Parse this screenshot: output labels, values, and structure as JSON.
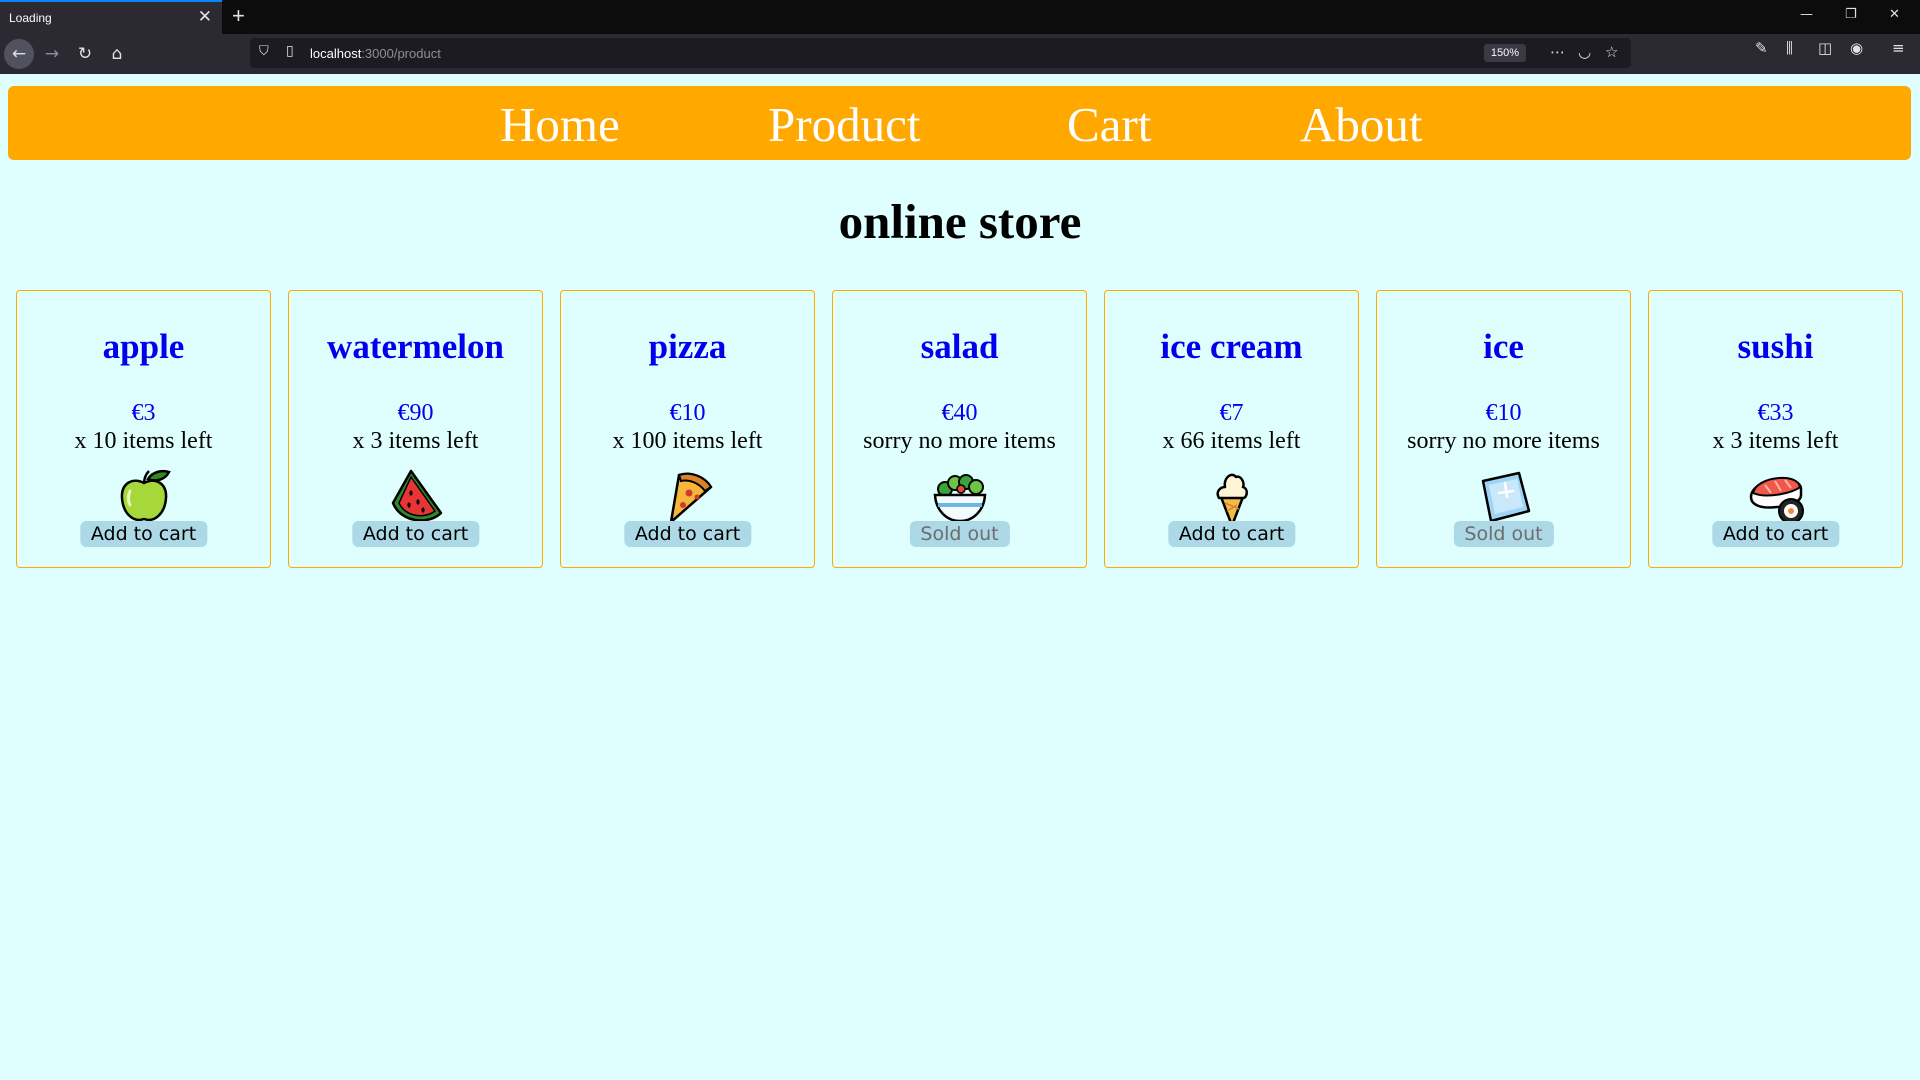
{
  "browser": {
    "tab_title": "Loading",
    "url_host": "localhost",
    "url_path": ":3000/product",
    "zoom": "150%"
  },
  "nav": {
    "items": [
      "Home",
      "Product",
      "Cart",
      "About"
    ]
  },
  "page": {
    "title": "online store"
  },
  "products": [
    {
      "name": "apple",
      "price": "€3",
      "stock": "x 10 items left",
      "button": "Add to cart",
      "available": true,
      "icon": "green-apple-icon"
    },
    {
      "name": "watermelon",
      "price": "€90",
      "stock": "x 3 items left",
      "button": "Add to cart",
      "available": true,
      "icon": "watermelon-icon"
    },
    {
      "name": "pizza",
      "price": "€10",
      "stock": "x 100 items left",
      "button": "Add to cart",
      "available": true,
      "icon": "pizza-icon"
    },
    {
      "name": "salad",
      "price": "€40",
      "stock": "sorry no more items",
      "button": "Sold out",
      "available": false,
      "icon": "salad-icon"
    },
    {
      "name": "ice cream",
      "price": "€7",
      "stock": "x 66 items left",
      "button": "Add to cart",
      "available": true,
      "icon": "ice-cream-icon"
    },
    {
      "name": "ice",
      "price": "€10",
      "stock": "sorry no more items",
      "button": "Sold out",
      "available": false,
      "icon": "ice-cube-icon"
    },
    {
      "name": "sushi",
      "price": "€33",
      "stock": "x 3 items left",
      "button": "Add to cart",
      "available": true,
      "icon": "sushi-icon"
    }
  ],
  "colors": {
    "page_background": "#dfffff",
    "nav_background": "#ffa800",
    "link_blue": "#0000ee",
    "button_background": "#add8e6"
  }
}
